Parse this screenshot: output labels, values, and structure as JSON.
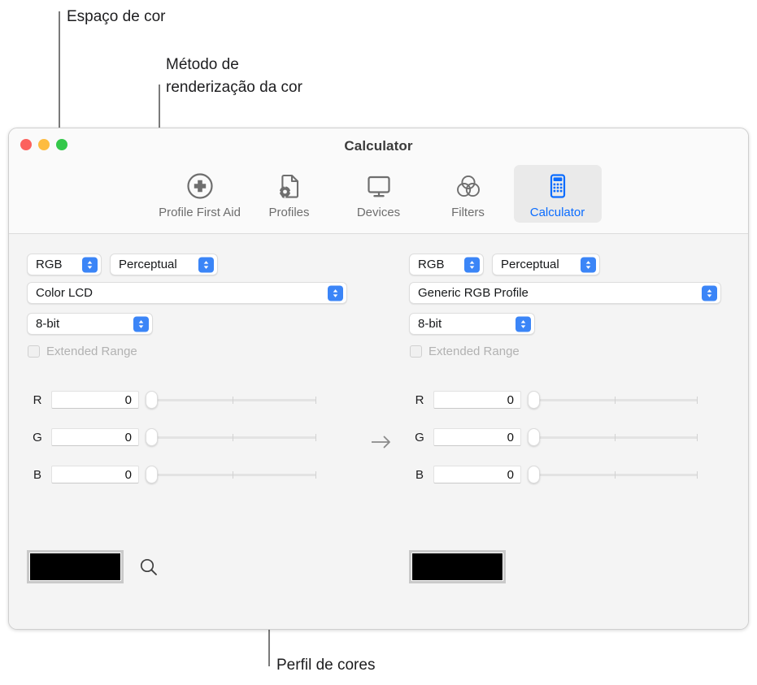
{
  "annotations": [
    {
      "id": "color-space",
      "text": "Espaço de cor"
    },
    {
      "id": "rendering-intent",
      "text": "Método de\nrenderização da cor"
    },
    {
      "id": "color-profile",
      "text": "Perfil de cores"
    }
  ],
  "window": {
    "title": "Calculator",
    "traffic_lights": {
      "close": "close-button",
      "minimize": "minimize-button",
      "zoom": "zoom-button"
    },
    "toolbar": {
      "items": [
        {
          "label": "Profile First Aid",
          "icon": "first-aid-icon",
          "selected": false
        },
        {
          "label": "Profiles",
          "icon": "profiles-document-gear-icon",
          "selected": false
        },
        {
          "label": "Devices",
          "icon": "display-monitor-icon",
          "selected": false
        },
        {
          "label": "Filters",
          "icon": "venn-circles-icon",
          "selected": false
        },
        {
          "label": "Calculator",
          "icon": "calculator-icon",
          "selected": true
        }
      ],
      "selected_color": "#0a6cff"
    }
  },
  "panels": {
    "left": {
      "color_space": "RGB",
      "rendering_intent": "Perceptual",
      "profile": "Color LCD",
      "bit_depth": "8-bit",
      "extended_range_label": "Extended Range",
      "extended_range_checked": false,
      "channels": [
        {
          "label": "R",
          "value": "0"
        },
        {
          "label": "G",
          "value": "0"
        },
        {
          "label": "B",
          "value": "0"
        }
      ],
      "swatch_color": "#000000",
      "loupe_icon": "magnifier-icon"
    },
    "right": {
      "color_space": "RGB",
      "rendering_intent": "Perceptual",
      "profile": "Generic RGB Profile",
      "bit_depth": "8-bit",
      "extended_range_label": "Extended Range",
      "extended_range_checked": false,
      "channels": [
        {
          "label": "R",
          "value": "0"
        },
        {
          "label": "G",
          "value": "0"
        },
        {
          "label": "B",
          "value": "0"
        }
      ],
      "swatch_color": "#000000"
    },
    "conversion_arrow_icon": "arrow-right-icon"
  }
}
